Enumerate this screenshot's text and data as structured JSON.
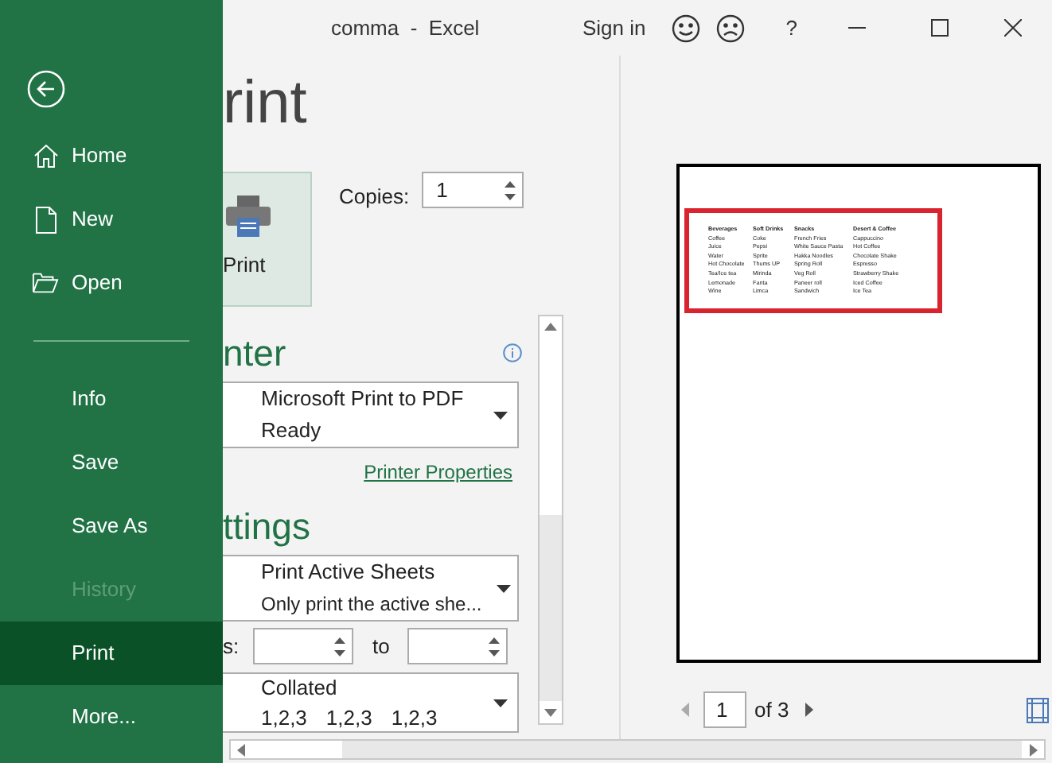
{
  "window": {
    "title": "comma  -  Excel",
    "sign_in": "Sign in",
    "help": "?"
  },
  "sidebar": {
    "items": [
      {
        "label": "Home",
        "kind": "home",
        "selected": false,
        "disabled": false
      },
      {
        "label": "New",
        "kind": "new",
        "selected": false,
        "disabled": false
      },
      {
        "label": "Open",
        "kind": "open",
        "selected": false,
        "disabled": false
      },
      {
        "label": "Info",
        "kind": "plain",
        "selected": false,
        "disabled": false
      },
      {
        "label": "Save",
        "kind": "plain",
        "selected": false,
        "disabled": false
      },
      {
        "label": "Save As",
        "kind": "plain",
        "selected": false,
        "disabled": false
      },
      {
        "label": "History",
        "kind": "plain",
        "selected": false,
        "disabled": true
      },
      {
        "label": "Print",
        "kind": "plain",
        "selected": true,
        "disabled": false
      },
      {
        "label": "More...",
        "kind": "plain",
        "selected": false,
        "disabled": false
      }
    ]
  },
  "heading": "rint",
  "print_button": "Print",
  "copies": {
    "label": "Copies:",
    "value": "1"
  },
  "printer": {
    "heading": "nter",
    "name": "Microsoft Print to PDF",
    "status": "Ready",
    "properties_link": "Printer Properties"
  },
  "settings": {
    "heading": "ttings",
    "what": {
      "title": "Print Active Sheets",
      "subtitle": "Only print the active she..."
    },
    "pages": {
      "label": "s:",
      "to_label": "to"
    },
    "collation": {
      "title": "Collated",
      "sets": [
        "1,2,3",
        "1,2,3",
        "1,2,3"
      ]
    }
  },
  "preview": {
    "table": {
      "columns": [
        "Beverages",
        "Soft Drinks",
        "Snacks",
        "Desert & Coffee"
      ],
      "rows": [
        [
          "Coffee",
          "Coke",
          "French Fries",
          "Cappuccino"
        ],
        [
          "Juice",
          "Pepsi",
          "White Sauce Pasta",
          "Hot Coffee"
        ],
        [
          "Water",
          "Sprite",
          "Hakka Noodles",
          "Chocolate Shake"
        ],
        [
          "Hot Chocolate",
          "Thums UP",
          "Spring Roll",
          "Espresso"
        ],
        [
          "Tea/Ice tea",
          "Mirinda",
          "Veg Roll",
          "Strawberry Shake"
        ],
        [
          "Lemonade",
          "Fanta",
          "Paneer roll",
          "Iced Coffee"
        ],
        [
          "Wine",
          "Limca",
          "Sandwich",
          "Ice Tea"
        ]
      ]
    },
    "page": "1",
    "of": "of 3"
  }
}
